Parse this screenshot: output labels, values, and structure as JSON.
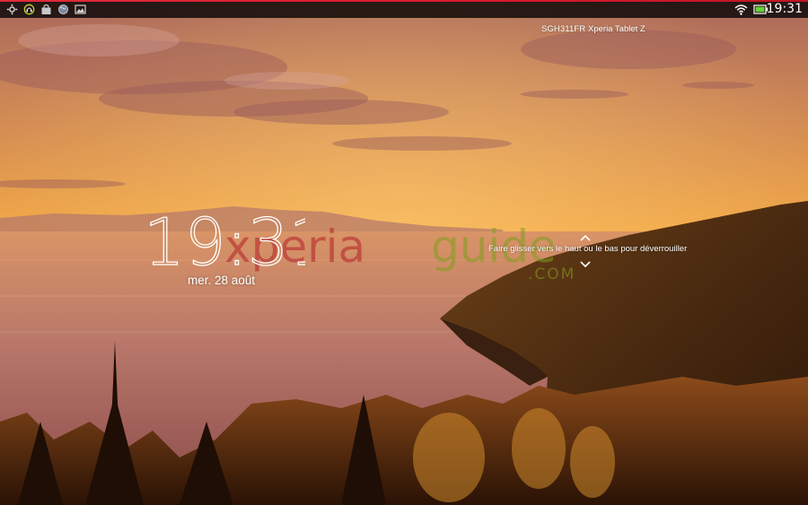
{
  "status_bar": {
    "accent_color": "#d81a2e",
    "left_icons": [
      "settings-icon",
      "headset-icon",
      "store-bag-icon",
      "globe-icon",
      "gallery-icon"
    ],
    "wifi_icon": "wifi-icon",
    "battery_icon": "battery-icon",
    "time": "19:31"
  },
  "lockscreen": {
    "carrier": "SGH311FR",
    "device_name": "Xperia Tablet Z",
    "time": "19:31",
    "date": "mer. 28 août",
    "unlock_hint": "Faire glisser vers le haut ou le bas pour déverrouiller"
  },
  "watermark": {
    "part1": "xperia",
    "part2": "guide",
    "suffix": ".COM"
  },
  "wallpaper": {
    "sky_color": "#e89a42",
    "sea_color": "#b0705a",
    "land_color": "#3a1e0c"
  }
}
